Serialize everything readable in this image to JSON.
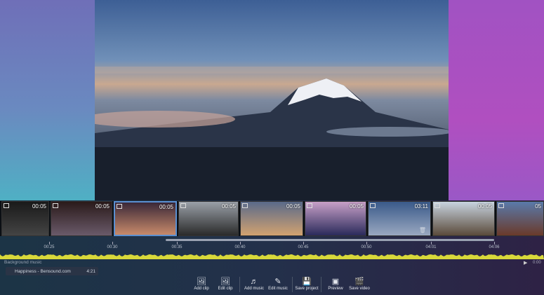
{
  "clips": [
    {
      "duration": "00:05",
      "type": "video",
      "colors": [
        "#1a1a1a",
        "#444"
      ]
    },
    {
      "duration": "00:05",
      "type": "image",
      "colors": [
        "#2a1a1a",
        "#6a5a6a"
      ]
    },
    {
      "duration": "00:05",
      "type": "image",
      "colors": [
        "#3a2838",
        "#c88a6a"
      ],
      "selected": true
    },
    {
      "duration": "00:05",
      "type": "image",
      "colors": [
        "#9aa0a8",
        "#2a2a2a"
      ]
    },
    {
      "duration": "00:05",
      "type": "image",
      "colors": [
        "#5a6a8a",
        "#d2a270"
      ]
    },
    {
      "duration": "00:05",
      "type": "image",
      "colors": [
        "#c8a0c8",
        "#2a2a5a"
      ]
    },
    {
      "duration": "03:11",
      "type": "video",
      "colors": [
        "#3a5a8a",
        "#9aa8c0"
      ]
    },
    {
      "duration": "00:05",
      "type": "image",
      "colors": [
        "#c8d4e0",
        "#5a4a3a"
      ]
    },
    {
      "duration": "05",
      "type": "image",
      "colors": [
        "#5a7aaa",
        "#6a3a2a"
      ]
    }
  ],
  "ruler": [
    "00:25",
    "00:30",
    "00:35",
    "00:40",
    "00:45",
    "00:50",
    "04:01",
    "04:06"
  ],
  "music": {
    "section_label": "Background music",
    "track_name": "Happiness - Bensound.com",
    "track_length": "4:21",
    "time": "0:00",
    "play_icon": "play-icon"
  },
  "toolbar": [
    {
      "label": "Add clip",
      "icon": "add-clip-icon",
      "glyph": "🖼"
    },
    {
      "label": "Edit clip",
      "icon": "edit-clip-icon",
      "glyph": "🖼"
    },
    {
      "label": "Add music",
      "icon": "add-music-icon",
      "glyph": "♬"
    },
    {
      "label": "Edit music",
      "icon": "edit-music-icon",
      "glyph": "✎"
    },
    {
      "label": "Save project",
      "icon": "save-project-icon",
      "glyph": "💾"
    },
    {
      "label": "Preview",
      "icon": "preview-icon",
      "glyph": "▣"
    },
    {
      "label": "Save video",
      "icon": "save-video-icon",
      "glyph": "🎬"
    }
  ],
  "colors": {
    "waveform": "#d8d83a",
    "accent": "#5a8fd0"
  }
}
